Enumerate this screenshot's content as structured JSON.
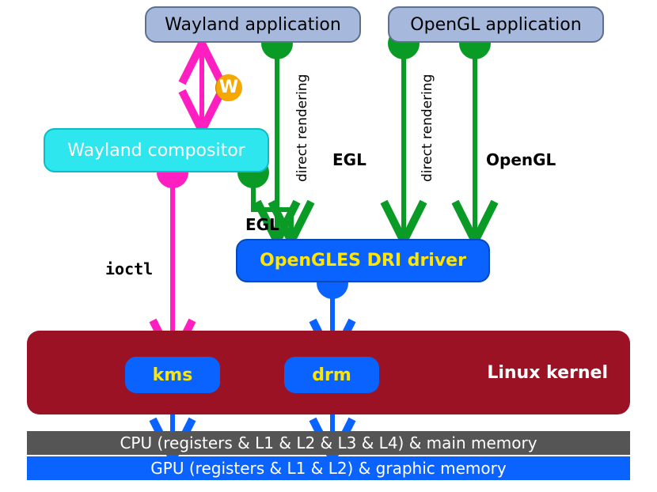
{
  "apps": {
    "wayland_app": "Wayland application",
    "opengl_app": "OpenGL application"
  },
  "compositor": "Wayland compositor",
  "dri_driver": "OpenGLES DRI driver",
  "kernel": {
    "label": "Linux kernel",
    "kms": "kms",
    "drm": "drm"
  },
  "bars": {
    "cpu": "CPU (registers  &  L1  &  L2  &  L3  &  L4) & main memory",
    "gpu": "GPU (registers  &  L1  &  L2) & graphic memory"
  },
  "arrow_labels": {
    "egl_left": "EGL",
    "egl_mid": "EGL",
    "opengl": "OpenGL",
    "direct_rendering_left": "direct rendering",
    "direct_rendering_right": "direct rendering",
    "ioctl": "ioctl"
  },
  "logo": "W",
  "colors": {
    "green": "#0a9a26",
    "magenta": "#ff1fc0",
    "blue": "#0a63ff"
  }
}
